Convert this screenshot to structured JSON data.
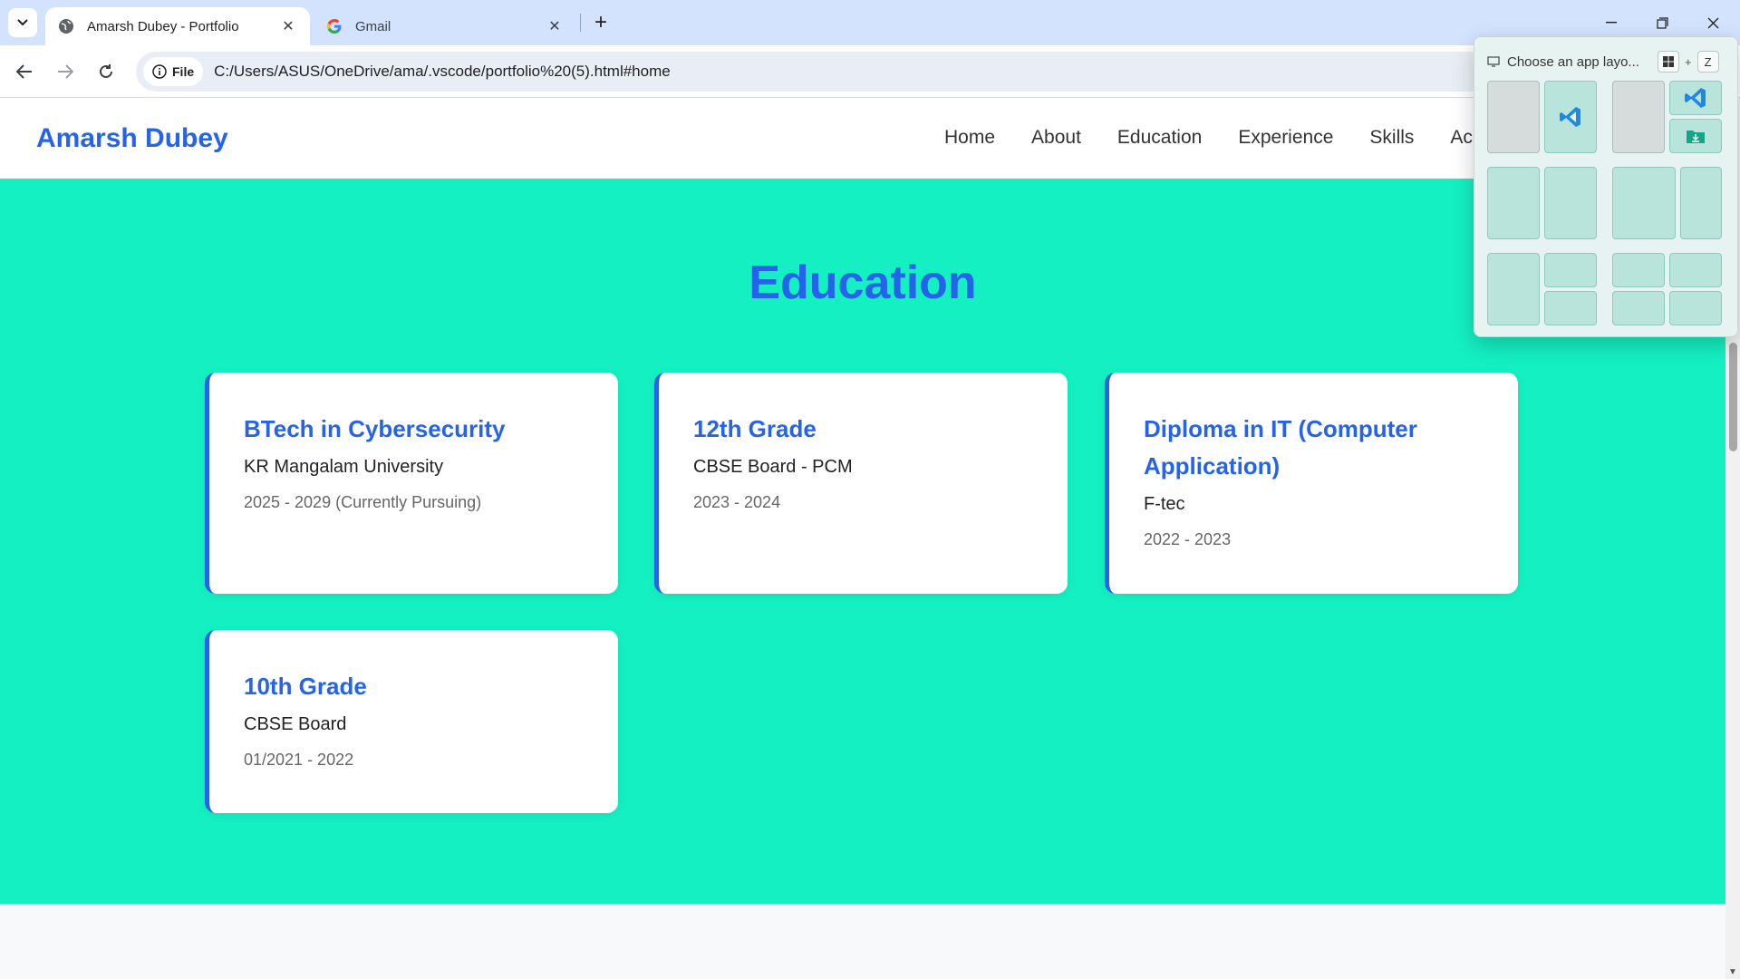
{
  "browser": {
    "tabs": [
      {
        "title": "Amarsh Dubey - Portfolio",
        "active": true,
        "icon": "globe-icon"
      },
      {
        "title": "Gmail",
        "active": false,
        "icon": "google-icon"
      }
    ],
    "address_chip": "File",
    "url": "C:/Users/ASUS/OneDrive/ama/.vscode/portfolio%20(5).html#home"
  },
  "site": {
    "brand": "Amarsh Dubey",
    "nav": [
      "Home",
      "About",
      "Education",
      "Experience",
      "Skills",
      "Ac"
    ]
  },
  "education": {
    "title": "Education",
    "cards": [
      {
        "degree": "BTech in Cybersecurity",
        "institution": "KR Mangalam University",
        "years": "2025 - 2029 (Currently Pursuing)"
      },
      {
        "degree": "12th Grade",
        "institution": "CBSE Board - PCM",
        "years": "2023 - 2024"
      },
      {
        "degree": "Diploma in IT (Computer Application)",
        "institution": "F-tec",
        "years": "2022 - 2023"
      },
      {
        "degree": "10th Grade",
        "institution": "CBSE Board",
        "years": "01/2021 - 2022"
      }
    ]
  },
  "snap_layouts": {
    "header": "Choose an app layo...",
    "shortcut_key": "Z"
  },
  "colors": {
    "accent": "#2563eb",
    "section_bg": "#14f0c2",
    "tabstrip": "#d3e3fd"
  }
}
